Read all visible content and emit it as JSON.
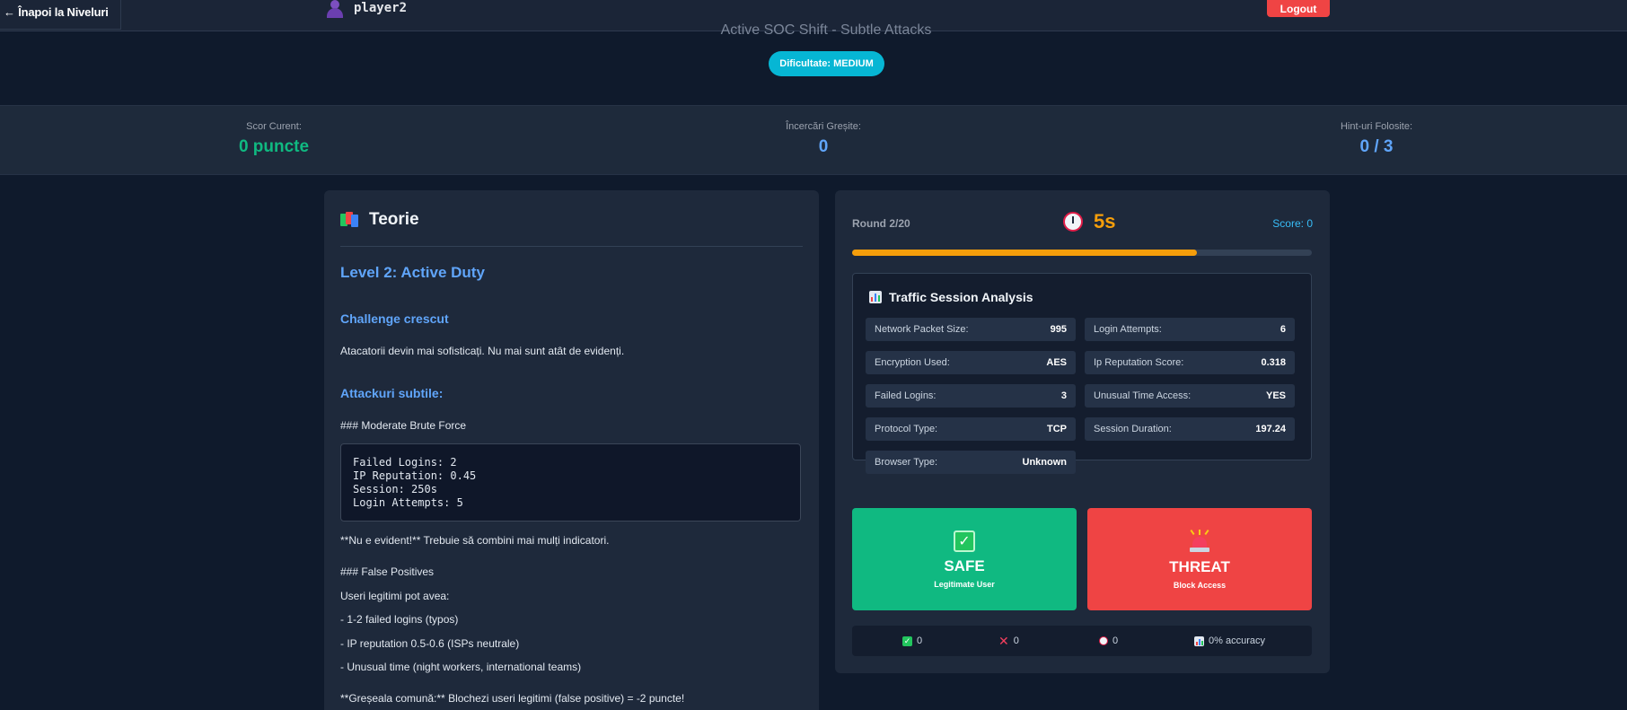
{
  "topbar": {
    "back_label": "← Înapoi la Niveluri",
    "username": "player2",
    "logout_label": "Logout"
  },
  "header": {
    "subtitle": "Active SOC Shift - Subtle Attacks",
    "difficulty": "Dificultate: MEDIUM"
  },
  "stats": {
    "score_label": "Scor Curent:",
    "score_value": "0 puncte",
    "wrong_label": "Încercări Greșite:",
    "wrong_value": "0",
    "hints_label": "Hint-uri Folosite:",
    "hints_value": "0 / 3"
  },
  "theory": {
    "title": "Teorie",
    "level_heading": "Level 2: Active Duty",
    "h_challenge": "Challenge crescut",
    "p_challenge": "Atacatorii devin mai sofisticați. Nu mai sunt atât de evidenți.",
    "h_subtle": "Attackuri subtile:",
    "p_brute": "### Moderate Brute Force",
    "code_lines": [
      "Failed Logins: 2",
      "IP Reputation: 0.45",
      "Session: 250s",
      "Login Attempts: 5"
    ],
    "p_not_obvious": "**Nu e evident!** Trebuie să combini mai mulți indicatori.",
    "p_false_pos": "### False Positives",
    "p_legit": "Useri legitimi pot avea:",
    "list": [
      "- 1-2 failed logins (typos)",
      "- IP reputation 0.5-0.6 (ISPs neutrale)",
      "- Unusual time (night workers, international teams)"
    ],
    "p_mistake": "**Greșeala comună:** Blochezi useri legitimi (false positive) = -2 puncte!"
  },
  "game": {
    "round": "Round 2/20",
    "timer": "5s",
    "score": "Score: 0",
    "progress": 0.75,
    "analysis_title": "Traffic Session Analysis",
    "metrics": [
      {
        "k": "Network Packet Size:",
        "v": "995"
      },
      {
        "k": "Login Attempts:",
        "v": "6"
      },
      {
        "k": "Encryption Used:",
        "v": "AES"
      },
      {
        "k": "Ip Reputation Score:",
        "v": "0.318"
      },
      {
        "k": "Failed Logins:",
        "v": "3"
      },
      {
        "k": "Unusual Time Access:",
        "v": "YES"
      },
      {
        "k": "Protocol Type:",
        "v": "TCP"
      },
      {
        "k": "Session Duration:",
        "v": "197.24"
      },
      {
        "k": "Browser Type:",
        "v": "Unknown"
      }
    ],
    "safe_label": "SAFE",
    "safe_sub": "Legitimate User",
    "threat_label": "THREAT",
    "threat_sub": "Block Access",
    "footer": {
      "correct": "0",
      "wrong": "0",
      "timeouts": "0",
      "accuracy": "0% accuracy"
    }
  },
  "colors": {
    "accent_green": "#10b981",
    "accent_red": "#ef4444",
    "accent_blue": "#60a5fa",
    "accent_orange": "#f59e0b",
    "accent_cyan": "#06b6d4"
  }
}
